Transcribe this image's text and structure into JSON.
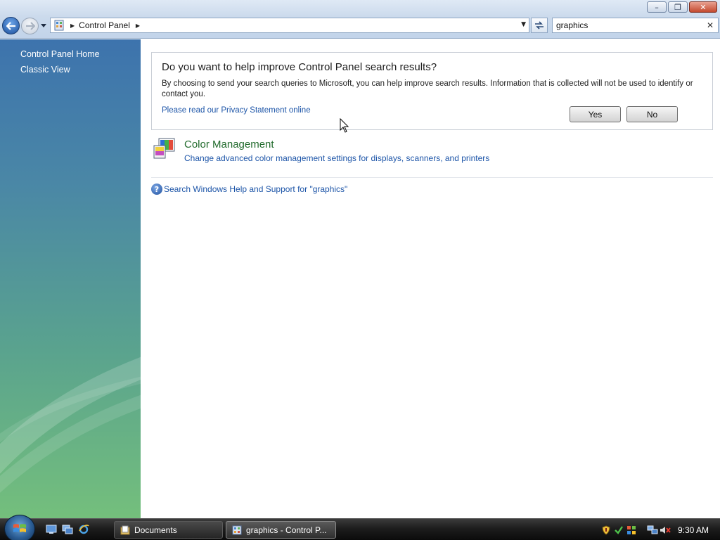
{
  "window": {
    "minimize_glyph": "–",
    "maximize_glyph": "❐",
    "close_glyph": "✕"
  },
  "address_bar": {
    "breadcrumb": "Control Panel"
  },
  "search": {
    "value": "graphics"
  },
  "left_pane": {
    "links": [
      {
        "label": "Control Panel Home"
      },
      {
        "label": "Classic View"
      }
    ]
  },
  "info_box": {
    "heading": "Do you want to help improve Control Panel search results?",
    "body": "By choosing to send your search queries to Microsoft, you can help improve search results. Information that is collected will not be used to identify or contact you.",
    "privacy_link": "Please read our Privacy Statement online",
    "yes_label": "Yes",
    "no_label": "No"
  },
  "results": [
    {
      "title": "Color Management",
      "description": "Change advanced color management settings for displays, scanners, and printers",
      "icon": "color-management-icon"
    }
  ],
  "help_link": "Search Windows Help and Support for \"graphics\"",
  "taskbar": {
    "tasks": [
      {
        "label": "Documents",
        "icon": "folder-icon"
      },
      {
        "label": "graphics - Control P...",
        "icon": "control-panel-icon"
      }
    ],
    "clock": "9:30 AM"
  },
  "colors": {
    "link_blue": "#1d55a8",
    "result_green": "#226b2d",
    "taskbar_black": "#1d1d1d"
  }
}
